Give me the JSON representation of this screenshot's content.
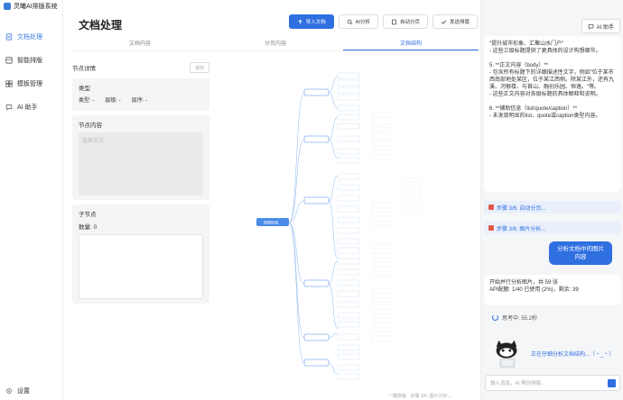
{
  "app": {
    "name": "灵曦AI排版系统"
  },
  "sidebar": {
    "items": [
      {
        "label": "文档处理",
        "active": true
      },
      {
        "label": "智能排版",
        "active": false
      },
      {
        "label": "模板管理",
        "active": false
      },
      {
        "label": "AI 助手",
        "active": false
      }
    ],
    "settings": "设置"
  },
  "main": {
    "title": "文档处理",
    "toolbar": [
      "导入文档",
      "AI分析",
      "自动分页",
      "发送排版"
    ],
    "tabs": [
      "文档内容",
      "分页内容",
      "文档结构"
    ],
    "active_tab": 2
  },
  "node_detail": {
    "title": "节点详情",
    "save": "保存",
    "type_header": "类型",
    "type_label": "类型: -",
    "level_label": "层级: -",
    "order_label": "层序: -",
    "content_header": "节点内容",
    "content_placeholder": "选择节点...",
    "children_header": "子节点",
    "children_count": "数量: 0"
  },
  "mindmap": {
    "root": "原国际城…",
    "labels": [
      "前言部…",
      "前言部…",
      "前言部…",
      "前言部…",
      "前言部…",
      "前言部…",
      "部分…",
      "前言部…",
      "前言部…",
      "前言部…",
      "部分…",
      "部分…",
      "部分…",
      "部分…",
      "部分…",
      "前言部…",
      "前言部…",
      "前言部…",
      "前言部…",
      "前言部…",
      "前言部…",
      "前言部…",
      "前言部…",
      "前言部…",
      "前言部…",
      "前言部…",
      "前言部…",
      "前言部…",
      "前言部…",
      "前言部…",
      "前言部…",
      "前言部…",
      "前言部…",
      "前言部…"
    ],
    "status": "一键排版 · 步骤 3/6: 图片分析..."
  },
  "chat": {
    "ai_button": "AI 助手",
    "first_msg": "\"提升城市形象、汇聚山水门户\"\n- 这些三级标题提供了更具体的设计构想细节。\n\n5. **正文内容（body）**\n- 包含所有标题下的详细描述性文字，例如\"位于某市西南部地处某区，位于某江西侧。除某江外，还有九溪、河根楼、与首山、融创乐园、恒逸。\"等。\n- 这些正文内容对各级标题的具体解释和说明。\n\n6. **辅助信息（list/quote/caption）**\n- 未发现明显的list、quote或caption类型内容。",
    "step1": "步骤 3/6: 自动分页...",
    "step2": "步骤 3/6: 图片分析...",
    "user_msg": "分析文档中的图片内容",
    "ai_msg": "开始并行分析图片，共 59 张\nAPI配额: 1/40 已使用 (2%)，剩余: 39",
    "thinking": "思考中: 55.2秒",
    "mascot_text": "正在仔细分析文档结构...（・_・）",
    "input_placeholder": "输入消息，AI 帮你排版..."
  }
}
